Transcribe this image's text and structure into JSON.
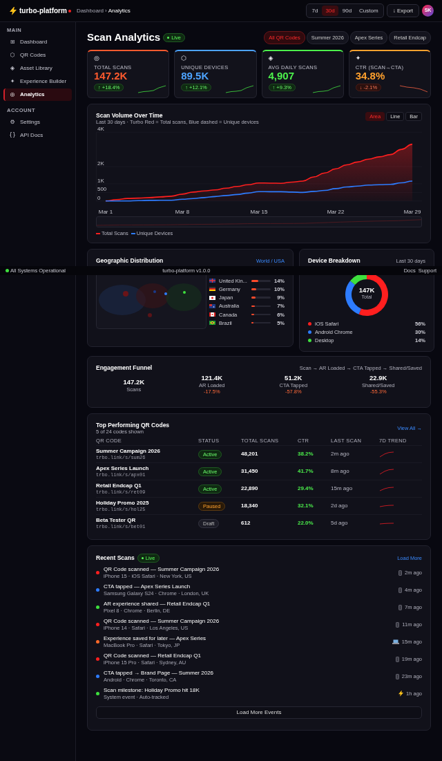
{
  "brand": {
    "name": "turbo-platform",
    "live_dot": true
  },
  "breadcrumb": {
    "items": [
      "Dashboard",
      "Analytics"
    ],
    "separator": "›"
  },
  "ranges": [
    {
      "label": "7d",
      "selected": false
    },
    {
      "label": "30d",
      "selected": true
    },
    {
      "label": "90d",
      "selected": false
    },
    {
      "label": "Custom",
      "selected": false
    }
  ],
  "export_button": {
    "icon": "↓",
    "label": "Export"
  },
  "avatar": {
    "initials": "SK"
  },
  "sidebar": {
    "sections": [
      {
        "title": "MAIN",
        "items": [
          {
            "icon": "⊞",
            "label": "Dashboard",
            "selected": false
          },
          {
            "icon": "⬡",
            "label": "QR Codes",
            "selected": false
          },
          {
            "icon": "◈",
            "label": "Asset Library",
            "selected": false
          },
          {
            "icon": "✦",
            "label": "Experience Builder",
            "selected": false
          },
          {
            "icon": "◎",
            "label": "Analytics",
            "selected": true
          }
        ]
      },
      {
        "title": "ACCOUNT",
        "items": [
          {
            "icon": "⚙",
            "label": "Settings",
            "selected": false
          },
          {
            "icon": "{}",
            "label": "API Docs",
            "selected": false
          }
        ]
      }
    ]
  },
  "page": {
    "title": "Scan Analytics",
    "badge": "Live"
  },
  "filters": [
    {
      "label": "All QR Codes",
      "selected": true
    },
    {
      "label": "Summer 2026",
      "selected": false
    },
    {
      "label": "Apex Series",
      "selected": false
    },
    {
      "label": "Retail Endcap",
      "selected": false
    }
  ],
  "kpis": [
    {
      "icon": "◎",
      "label": "TOTAL SCANS",
      "value": "147.2K",
      "delta": "↑ +18.4%",
      "kind": "up",
      "color": "#ff5a2e"
    },
    {
      "icon": "⬡",
      "label": "UNIQUE DEVICES",
      "value": "89.5K",
      "delta": "↑ +12.1%",
      "kind": "up",
      "color": "#4da3ff"
    },
    {
      "icon": "◈",
      "label": "AVG DAILY SCANS",
      "value": "4,907",
      "delta": "↑ +9.3%",
      "kind": "up",
      "color": "#4cf04c"
    },
    {
      "icon": "✦",
      "label": "CTR (SCAN→CTA)",
      "value": "34.8%",
      "delta": "↓ -2.1%",
      "kind": "down",
      "color": "#ffa12e"
    }
  ],
  "volume_chart": {
    "title": "Scan Volume Over Time",
    "subtitle": "Last 30 days · Turbo Red = Total scans, Blue dashed = Unique devices",
    "views": [
      {
        "label": "Area",
        "selected": true
      },
      {
        "label": "Line",
        "selected": false
      },
      {
        "label": "Bar",
        "selected": false
      }
    ],
    "chart_data": {
      "type": "area",
      "categories": [
        "Mar 1",
        null,
        null,
        null,
        null,
        null,
        null,
        "Mar 8",
        null,
        null,
        null,
        null,
        null,
        null,
        "Mar 15",
        null,
        null,
        null,
        null,
        null,
        null,
        "Mar 22",
        null,
        null,
        null,
        null,
        null,
        null,
        "Mar 29"
      ],
      "yticks": [
        {
          "value": 0,
          "label": "0"
        },
        {
          "value": 500,
          "label": "500"
        },
        {
          "value": 1000,
          "label": "1K"
        },
        {
          "value": 2000,
          "label": "2K"
        },
        {
          "value": 4000,
          "label": "4K"
        }
      ],
      "ylim": [
        0,
        4000
      ],
      "series": [
        {
          "name": "Total Scans",
          "color": "#ff1f1f",
          "values": [
            10,
            80,
            150,
            170,
            200,
            240,
            280,
            400,
            520,
            590,
            650,
            750,
            850,
            950,
            1050,
            1040,
            1030,
            1100,
            1160,
            1400,
            1630,
            1870,
            2100,
            2270,
            2430,
            2570,
            2700,
            3000,
            3300
          ]
        },
        {
          "name": "Unique Devices",
          "type": "line",
          "color": "#2d7cff",
          "values": [
            0,
            0,
            0,
            20,
            35,
            40,
            45,
            100,
            145,
            200,
            260,
            320,
            380,
            460,
            545,
            540,
            540,
            520,
            500,
            560,
            615,
            720,
            815,
            870,
            925,
            945,
            965,
            1060,
            1160
          ]
        }
      ]
    }
  },
  "geo": {
    "title": "Geographic Distribution",
    "link": "World / USA",
    "countries": [
      {
        "name": "United Kin...",
        "share": "14%",
        "level": 0.35
      },
      {
        "name": "Germany",
        "share": "10%",
        "level": 0.25
      },
      {
        "name": "Japan",
        "share": "9%",
        "level": 0.22
      },
      {
        "name": "Australia",
        "share": "7%",
        "level": 0.17
      },
      {
        "name": "Canada",
        "share": "6%",
        "level": 0.13
      },
      {
        "name": "Brazil",
        "share": "5%",
        "level": 0.12
      }
    ]
  },
  "devices": {
    "title": "Device Breakdown",
    "period": "Last 30 days",
    "center_value": "147K",
    "center_label": "Total",
    "legend": [
      {
        "share": "56%",
        "color": "#ff1f1f"
      },
      {
        "share": "30%",
        "color": "#2d7cff"
      },
      {
        "share": "14%",
        "color": "#3ee03e"
      }
    ],
    "chart_data": {
      "type": "donut",
      "categories": [
        "iOS Safari",
        "Android Chrome",
        "Desktop"
      ],
      "values": [
        56,
        30,
        14
      ]
    }
  },
  "funnel": {
    "title": "Engagement Funnel",
    "path": "Scan → AR Loaded → CTA Tapped → Shared/Saved",
    "steps": [
      {
        "value": "147.2K",
        "label": "Scans"
      },
      {
        "value": "121.4K",
        "label": "AR Loaded",
        "drop": "-17.5%"
      },
      {
        "value": "51.2K",
        "label": "CTA Tapped",
        "drop": "-57.8%"
      },
      {
        "value": "22.9K",
        "label": "Shared/Saved",
        "drop": "-55.3%"
      }
    ]
  },
  "top_codes": {
    "title": "Top Performing QR Codes",
    "subtitle": "5 of 24 codes shown",
    "link": "View All →",
    "columns": [
      "QR CODE",
      "STATUS",
      "TOTAL SCANS",
      "CTR",
      "LAST SCAN",
      "7D TREND"
    ],
    "rows": [
      {
        "name": "Summer Campaign 2026",
        "url": "trbo.link/s/sum26",
        "status": "Active",
        "kind": "active",
        "scans": "48,201",
        "ctr": "38.2%",
        "last_scan": "2m ago"
      },
      {
        "name": "Apex Series Launch",
        "url": "trbo.link/s/apx01",
        "status": "Active",
        "kind": "active",
        "scans": "31,450",
        "ctr": "41.7%",
        "last_scan": "8m ago"
      },
      {
        "name": "Retail Endcap Q1",
        "url": "trbo.link/s/ret09",
        "status": "Active",
        "kind": "active",
        "scans": "22,890",
        "ctr": "29.4%",
        "last_scan": "15m ago"
      },
      {
        "name": "Holiday Promo 2025",
        "url": "trbo.link/s/hol25",
        "status": "Paused",
        "kind": "paused",
        "scans": "18,340",
        "ctr": "32.1%",
        "last_scan": "2d ago"
      },
      {
        "name": "Beta Tester QR",
        "url": "trbo.link/s/bet01",
        "status": "Draft",
        "kind": "draft",
        "scans": "612",
        "ctr": "22.0%",
        "last_scan": "5d ago"
      }
    ]
  },
  "recent": {
    "title": "Recent Scans",
    "badge": "Live",
    "link": "Load More",
    "button": "Load More Events",
    "events": [
      {
        "title": "QR Code scanned — Summer Campaign 2026",
        "meta": "iPhone 15 · iOS Safari · New York, US",
        "color": "#ff1f1f",
        "kind": "phone",
        "time": "2m ago"
      },
      {
        "title": "CTA tapped — Apex Series Launch",
        "meta": "Samsung Galaxy S24 · Chrome · London, UK",
        "color": "#2d7cff",
        "kind": "phone",
        "time": "4m ago"
      },
      {
        "title": "AR experience shared — Retail Endcap Q1",
        "meta": "Pixel 8 · Chrome · Berlin, DE",
        "color": "#3ee03e",
        "kind": "phone",
        "time": "7m ago"
      },
      {
        "title": "QR Code scanned — Summer Campaign 2026",
        "meta": "iPhone 14 · Safari · Los Angeles, US",
        "color": "#ff1f1f",
        "kind": "phone",
        "time": "11m ago"
      },
      {
        "title": "Experience saved for later — Apex Series",
        "meta": "MacBook Pro · Safari · Tokyo, JP",
        "color": "#ff6a2a",
        "kind": "laptop",
        "time": "15m ago"
      },
      {
        "title": "QR Code scanned — Retail Endcap Q1",
        "meta": "iPhone 15 Pro · Safari · Sydney, AU",
        "color": "#ff1f1f",
        "kind": "phone",
        "time": "19m ago"
      },
      {
        "title": "CTA tapped → Brand Page — Summer 2026",
        "meta": "Android · Chrome · Toronto, CA",
        "color": "#2d7cff",
        "kind": "phone",
        "time": "23m ago"
      },
      {
        "title": "Scan milestone: Holiday Promo hit 18K",
        "meta": "System event · Auto-tracked",
        "color": "#3ee03e",
        "kind": "system",
        "time": "1h ago"
      }
    ]
  },
  "status_bar": {
    "operational": true,
    "status": "All Systems Operational",
    "version": "turbo-platform v1.0.0",
    "links": [
      "Docs",
      "Support"
    ]
  }
}
